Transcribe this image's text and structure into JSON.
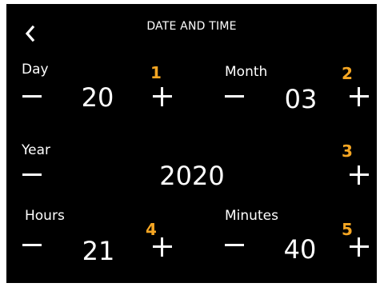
{
  "header": {
    "title": "DATE AND TIME",
    "back_icon": "chevron-left-icon"
  },
  "fields": {
    "day": {
      "label": "Day",
      "value": "20",
      "badge": "1"
    },
    "month": {
      "label": "Month",
      "value": "03",
      "badge": "2"
    },
    "year": {
      "label": "Year",
      "value": "2020",
      "badge": "3"
    },
    "hours": {
      "label": "Hours",
      "value": "21",
      "badge": "4"
    },
    "minutes": {
      "label": "Minutes",
      "value": "40",
      "badge": "5"
    }
  },
  "colors": {
    "background": "#000000",
    "text": "#ffffff",
    "badge": "#f5a623"
  }
}
